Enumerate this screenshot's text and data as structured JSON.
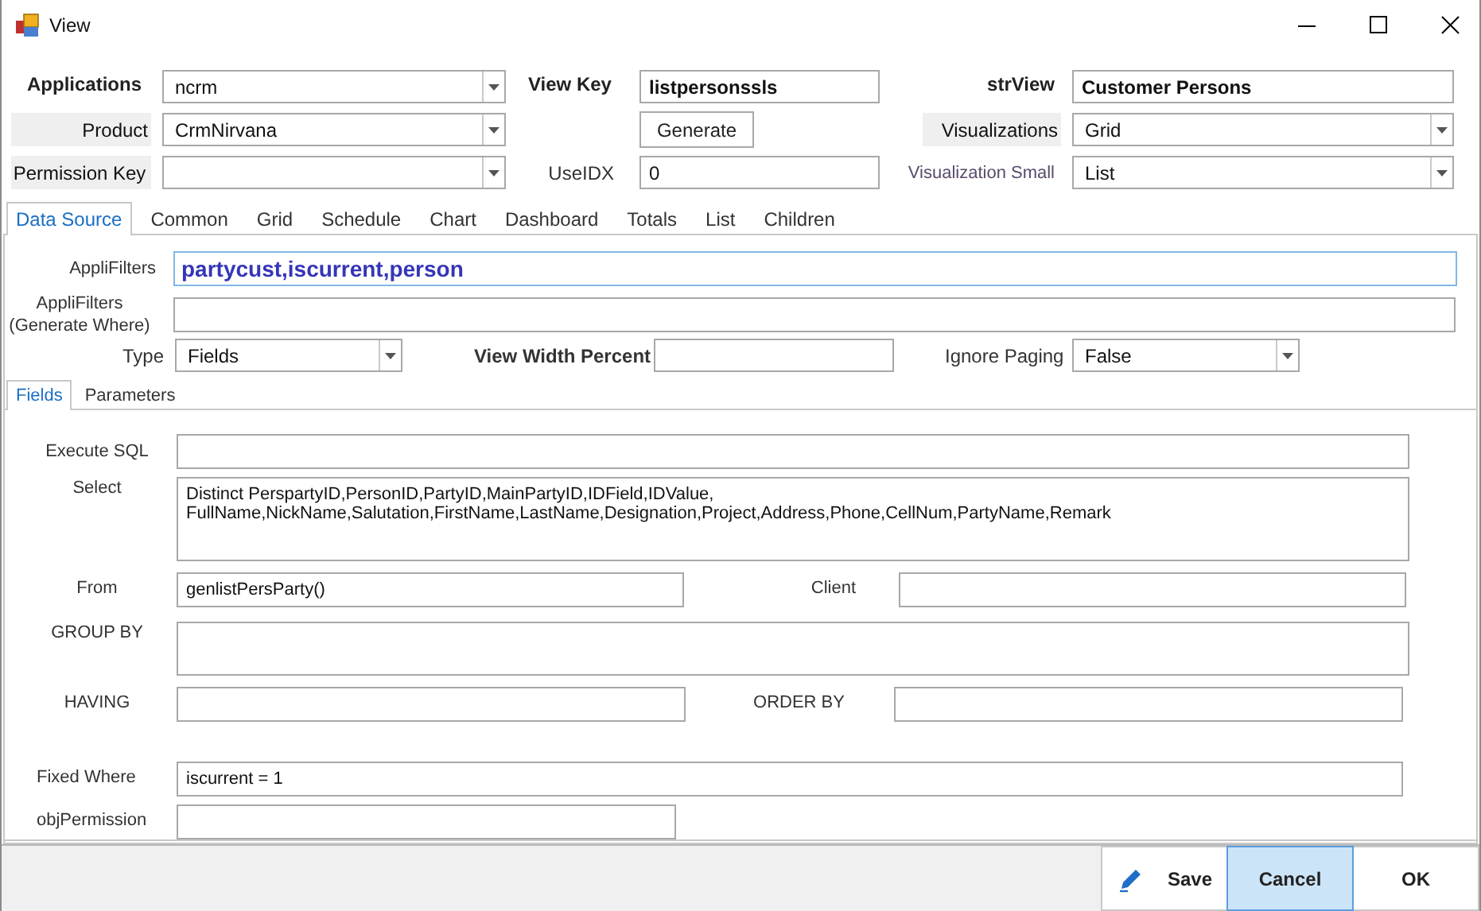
{
  "window": {
    "title": "View"
  },
  "header": {
    "applications": {
      "label": "Applications",
      "value": "ncrm"
    },
    "view_key": {
      "label": "View Key",
      "value": "listpersonssls"
    },
    "str_view": {
      "label": "strView",
      "value": "Customer Persons"
    },
    "product": {
      "label": "Product",
      "value": "CrmNirvana"
    },
    "generate_button": "Generate",
    "visualizations": {
      "label": "Visualizations",
      "value": "Grid"
    },
    "permission_key": {
      "label": "Permission Key"
    },
    "use_idx": {
      "label": "UseIDX",
      "value": "0"
    },
    "visualization_small": {
      "label": "Visualization Small",
      "value": "List"
    }
  },
  "tabs": [
    {
      "label": "Data Source",
      "selected": true
    },
    {
      "label": "Common",
      "selected": false
    },
    {
      "label": "Grid",
      "selected": false
    },
    {
      "label": "Schedule",
      "selected": false
    },
    {
      "label": "Chart",
      "selected": false
    },
    {
      "label": "Dashboard",
      "selected": false
    },
    {
      "label": "Totals",
      "selected": false
    },
    {
      "label": "List",
      "selected": false
    },
    {
      "label": "Children",
      "selected": false
    }
  ],
  "data_source": {
    "appli_filters": {
      "label": "AppliFilters",
      "value": "partycust,iscurrent,person"
    },
    "generate_where": {
      "label": "AppliFilters (Generate Where)"
    },
    "type": {
      "label": "Type",
      "value": "Fields"
    },
    "view_width_percent": {
      "label": "View Width Percent"
    },
    "ignore_paging": {
      "label": "Ignore Paging",
      "value": "False"
    }
  },
  "sub_tabs": [
    {
      "label": "Fields",
      "selected": true
    },
    {
      "label": "Parameters",
      "selected": false
    }
  ],
  "fields": [
    [
      {
        "label": "Execute SQL",
        "multiline": false
      }
    ],
    [
      {
        "label": "Select",
        "value": "Distinct PerspartyID,PersonID,PartyID,MainPartyID,IDField,IDValue,\nFullName,NickName,Salutation,FirstName,LastName,Designation,Project,Address,Phone,CellNum,PartyName,Remark",
        "multiline": true
      }
    ],
    [
      {
        "label": "From",
        "value": "genlistPersParty()",
        "multiline": false
      },
      {
        "label": "Client",
        "multiline": false
      }
    ],
    [
      {
        "label": "GROUP BY",
        "multiline": true
      }
    ],
    [
      {
        "label": "HAVING",
        "multiline": false
      },
      {
        "label": "ORDER BY",
        "multiline": false
      }
    ],
    [
      {
        "label": "Fixed Where",
        "value": "iscurrent = 1",
        "multiline": false
      }
    ],
    [
      {
        "label": "objPermission",
        "multiline": false
      }
    ]
  ],
  "buttons": [
    {
      "label": "Save",
      "kind": "with_icon",
      "selected": false
    },
    {
      "label": "Cancel",
      "kind": "plain",
      "selected": true
    },
    {
      "label": "OK",
      "kind": "plain",
      "selected": false
    }
  ]
}
